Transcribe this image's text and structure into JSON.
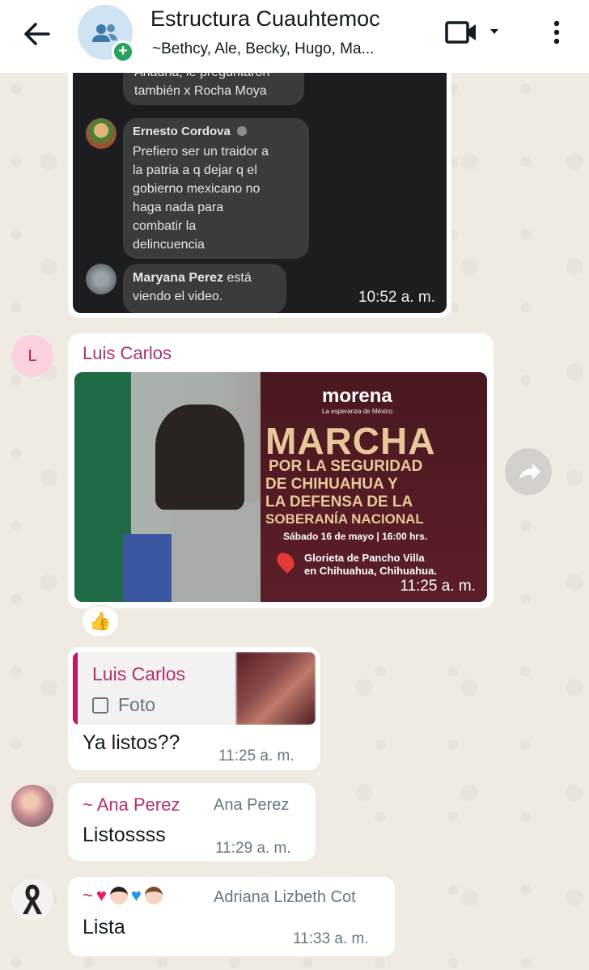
{
  "header": {
    "title": "Estructura Cuauhtemoc",
    "subtitle": "~Bethcy, Ale, Becky, Hugo, Ma..."
  },
  "forwarded_screenshot": {
    "fragment_text": "Ariadna, le preguntaron también x Rocha Moya",
    "comment1": {
      "name": "Ernesto Cordova",
      "lines": [
        "Prefiero ser un traidor a",
        "la patria a q dejar q el",
        "gobierno mexicano no",
        "haga nada para",
        "combatir la",
        "delincuencia"
      ]
    },
    "comment2": {
      "name": "Maryana Perez",
      "text_after_name": " está",
      "line2": "viendo el video."
    },
    "time": "10:52 a. m."
  },
  "image_message": {
    "avatar_letter": "L",
    "sender": "Luis Carlos",
    "time": "11:25 a. m.",
    "poster": {
      "brand": "morena",
      "brand_sub": "La esperanza de México",
      "headline": "MARCHA",
      "lines": [
        "POR LA SEGURIDAD",
        "DE CHIHUAHUA Y",
        "LA DEFENSA DE LA",
        "SOBERANÍA NACIONAL"
      ],
      "date": "Sábado 16 de mayo | 16:00 hrs.",
      "place1": "Glorieta de Pancho Villa",
      "place2": "en Chihuahua, Chihuahua."
    },
    "reaction": "👍"
  },
  "reply_message": {
    "quoted_name": "Luis Carlos",
    "quoted_type": "Foto",
    "text": "Ya listos??",
    "time": "11:25 a. m."
  },
  "ana_message": {
    "sender": "~ Ana Perez",
    "push_name": "Ana Perez",
    "text": "Listossss",
    "time": "11:29 a. m."
  },
  "adriana_message": {
    "sender_prefix": "~",
    "push_name": "Adriana Lizbeth Cot",
    "text": "Lista",
    "time": "11:33 a. m."
  }
}
